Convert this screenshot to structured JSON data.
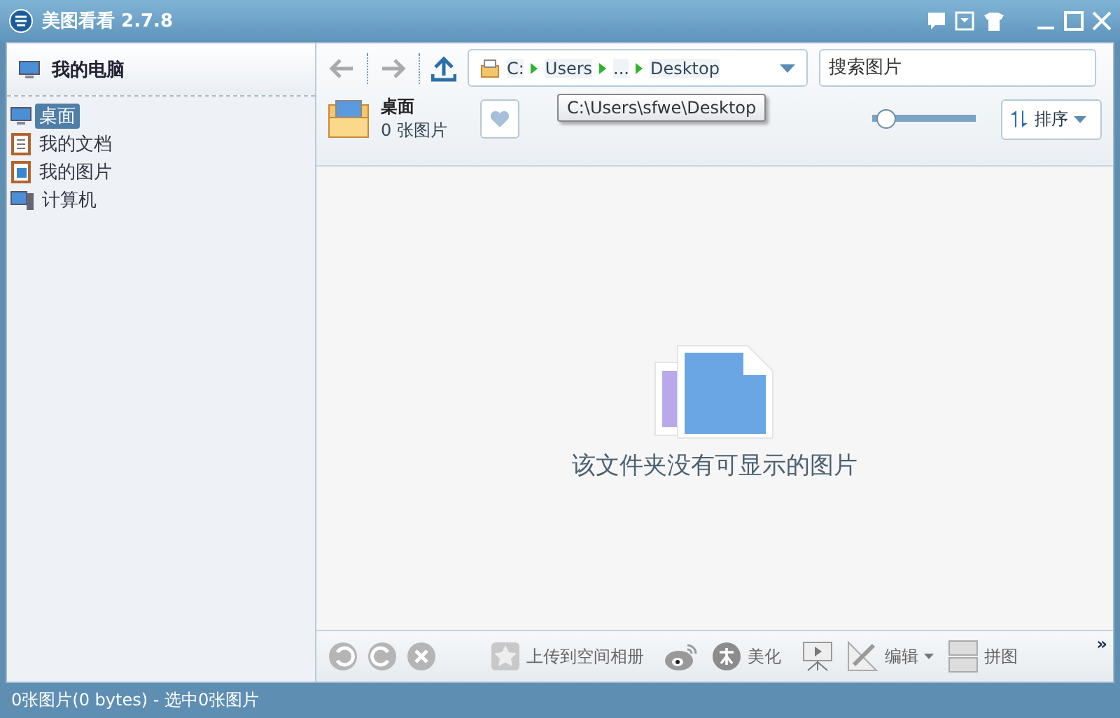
{
  "window": {
    "title": "美图看看 2.7.8"
  },
  "sidebar": {
    "header": "我的电脑",
    "items": [
      {
        "label": "桌面",
        "kind": "desktop",
        "selected": true
      },
      {
        "label": "我的文档",
        "kind": "documents",
        "selected": false
      },
      {
        "label": "我的图片",
        "kind": "pictures",
        "selected": false
      },
      {
        "label": "计算机",
        "kind": "computer",
        "selected": false
      }
    ]
  },
  "address": {
    "segments": [
      "C:",
      "Users",
      "...",
      "Desktop"
    ],
    "tooltip": "C:\\Users\\sfwe\\Desktop"
  },
  "search": {
    "placeholder": "搜索图片"
  },
  "folder": {
    "name": "桌面",
    "count": "0 张图片"
  },
  "zoom": {
    "level": 0.05
  },
  "sort": {
    "label": "排序"
  },
  "empty_message": "该文件夹没有可显示的图片",
  "bottom_toolbar": [
    {
      "kind": "rotate-left"
    },
    {
      "kind": "rotate-right"
    },
    {
      "kind": "delete"
    },
    {
      "kind": "upload",
      "label": "上传到空间相册"
    },
    {
      "kind": "weibo"
    },
    {
      "kind": "beautify",
      "label": "美化"
    },
    {
      "kind": "slideshow"
    },
    {
      "kind": "edit",
      "label": "编辑"
    },
    {
      "kind": "collage",
      "label": "拼图"
    }
  ],
  "overflow": "»",
  "status_bar": "0张图片(0 bytes) - 选中0张图片"
}
